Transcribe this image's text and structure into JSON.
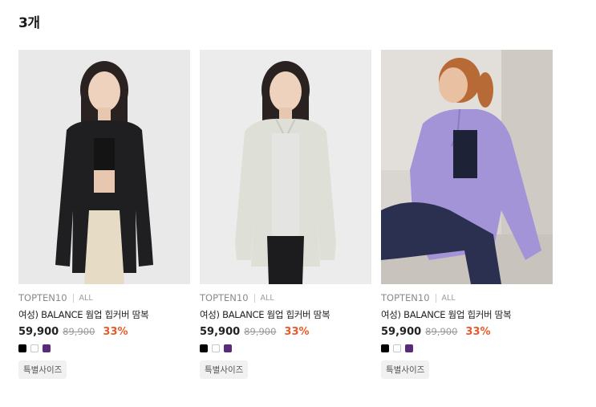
{
  "result_count": "3개",
  "products": [
    {
      "brand": "TOPTEN10",
      "category": "ALL",
      "title": "여성) BALANCE 웜업 힙커버 땀복",
      "price": "59,900",
      "original_price": "89,900",
      "discount": "33%",
      "colors": [
        "#000000",
        "#ffffff",
        "#5b2a7a"
      ],
      "tag": "특별사이즈",
      "image": "woman-black-jacket-photo"
    },
    {
      "brand": "TOPTEN10",
      "category": "ALL",
      "title": "여성) BALANCE 웜업 힙커버 땀복",
      "price": "59,900",
      "original_price": "89,900",
      "discount": "33%",
      "colors": [
        "#000000",
        "#ffffff",
        "#5b2a7a"
      ],
      "tag": "특별사이즈",
      "image": "woman-ivory-jacket-photo"
    },
    {
      "brand": "TOPTEN10",
      "category": "ALL",
      "title": "여성) BALANCE 웜업 힙커버 땀복",
      "price": "59,900",
      "original_price": "89,900",
      "discount": "33%",
      "colors": [
        "#000000",
        "#ffffff",
        "#5b2a7a"
      ],
      "tag": "특별사이즈",
      "image": "woman-lavender-jacket-photo"
    }
  ]
}
